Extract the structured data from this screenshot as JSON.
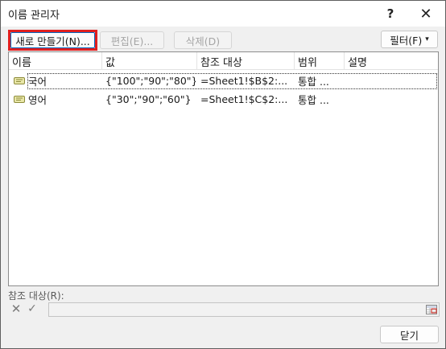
{
  "window": {
    "title": "이름 관리자",
    "help_glyph": "?",
    "close_glyph": "✕"
  },
  "toolbar": {
    "new_label": "새로 만들기(N)...",
    "edit_label": "편집(E)...",
    "delete_label": "삭제(D)",
    "filter_label": "필터(F)",
    "filter_caret": "▾"
  },
  "grid": {
    "columns": [
      "이름",
      "값",
      "참조 대상",
      "범위",
      "설명"
    ],
    "rows": [
      {
        "name": "국어",
        "value": "{\"100\";\"90\";\"80\"}",
        "refers_to": "=Sheet1!$B$2:...",
        "scope": "통합 ...",
        "comment": "",
        "selected": true
      },
      {
        "name": "영어",
        "value": "{\"30\";\"90\";\"60\"}",
        "refers_to": "=Sheet1!$C$2:...",
        "scope": "통합 ...",
        "comment": "",
        "selected": false
      }
    ]
  },
  "refers_to_panel": {
    "label": "참조 대상(R):",
    "value": "",
    "cancel_glyph": "✕",
    "ok_glyph": "✓"
  },
  "footer": {
    "close_label": "닫기"
  },
  "colors": {
    "highlight_border": "#e01f1f",
    "focus_border": "#0067c0",
    "dialog_bg": "#f0f0f0"
  }
}
